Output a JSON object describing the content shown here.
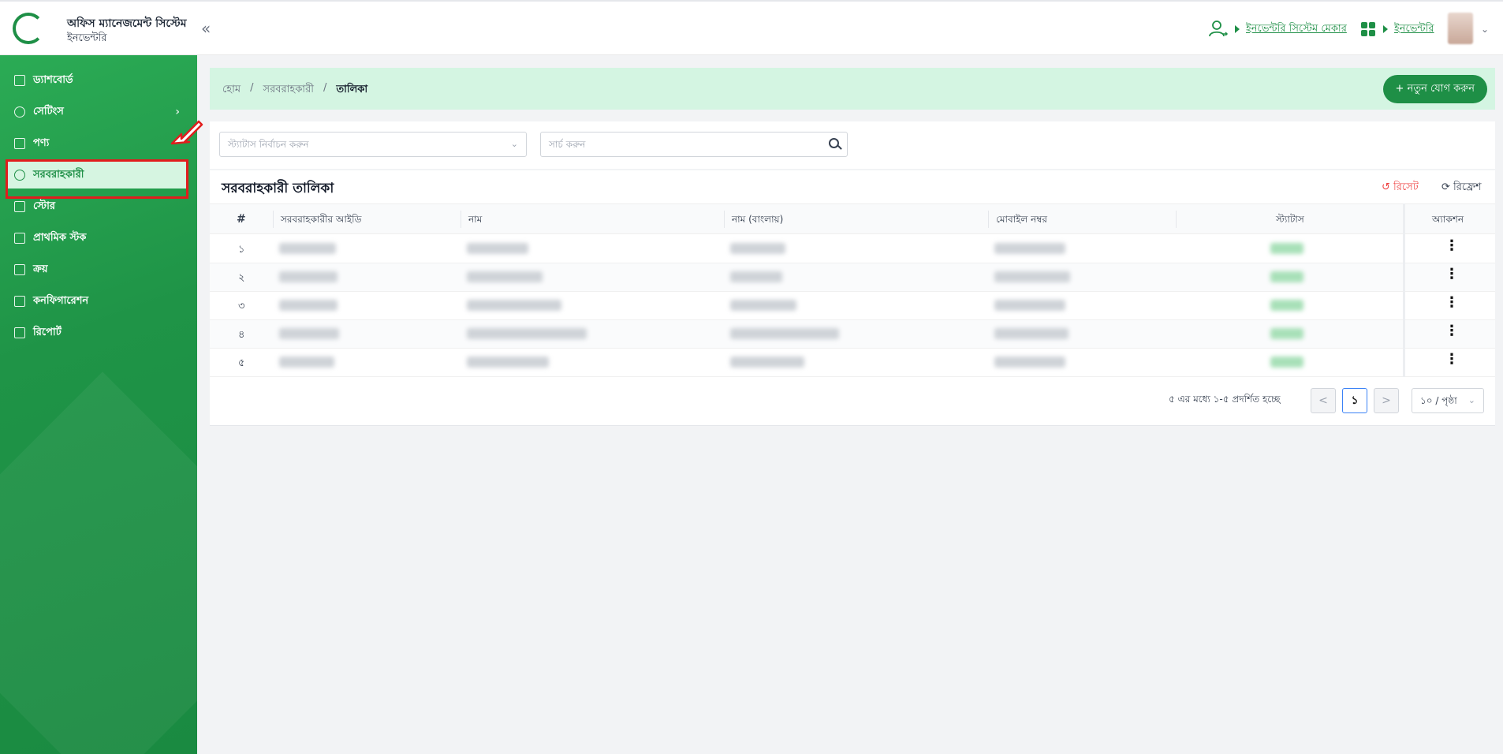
{
  "header": {
    "title": "অফিস ম্যানেজমেন্ট সিস্টেম",
    "subtitle": "ইনভেন্টরি",
    "collapse_icon": "«",
    "role_link": "ইনভেন্টরি সিস্টেম মেকার",
    "module_link": "ইনভেন্টরি",
    "accent_color": "#1e8f46"
  },
  "sidebar": {
    "items": [
      {
        "label": "ড্যাশবোর্ড",
        "icon": "dashboard-icon"
      },
      {
        "label": "সেটিংস",
        "icon": "gear-icon"
      },
      {
        "label": "পণ্য",
        "icon": "box-icon"
      },
      {
        "label": "সরবরাহকারী",
        "icon": "supplier-icon"
      },
      {
        "label": "স্টোর",
        "icon": "store-icon"
      },
      {
        "label": "প্রাথমিক স্টক",
        "icon": "stock-icon"
      },
      {
        "label": "ক্রয়",
        "icon": "purchase-icon"
      },
      {
        "label": "কনফিগারেশন",
        "icon": "sliders-icon"
      },
      {
        "label": "রিপোর্ট",
        "icon": "report-icon"
      }
    ],
    "active_index": 3
  },
  "breadcrumb": {
    "home": "হোম",
    "section": "সরবরাহকারী",
    "current": "তালিকা"
  },
  "actions": {
    "add_new": "+ নতুন যোগ করুন"
  },
  "filters": {
    "status_placeholder": "স্ট্যাটাস নির্বাচন করুন",
    "search_placeholder": "সার্চ করুন"
  },
  "table": {
    "title": "সরবরাহকারী তালিকা",
    "reset": "রিসেট",
    "refresh": "রিফ্রেশ",
    "columns": [
      "#",
      "সরবরাহকারীর আইডি",
      "নাম",
      "নাম (বাংলায়)",
      "মোবাইল নম্বর",
      "স্ট্যাটাস",
      "অ্যাকশন"
    ],
    "rows": [
      "১",
      "২",
      "৩",
      "৪",
      "৫"
    ]
  },
  "pagination": {
    "summary": "৫ এর মধ্যে ১-৫ প্রদর্শিত হচ্ছে",
    "prev": "<",
    "page": "১",
    "next": ">",
    "page_size": "১০ / পৃষ্ঠা"
  }
}
